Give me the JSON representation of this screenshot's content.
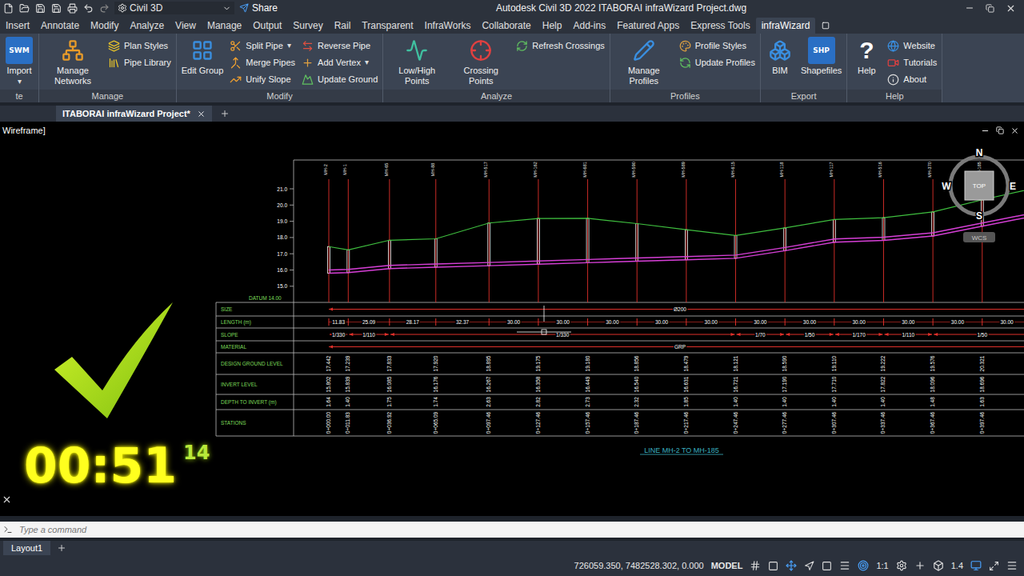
{
  "title_bar": {
    "workspace": "Civil 3D",
    "share": "Share",
    "title": "Autodesk Civil 3D 2022  ITABORAI infraWizard Project.dwg"
  },
  "menu_tabs": [
    {
      "label": "Insert",
      "selected": false
    },
    {
      "label": "Annotate",
      "selected": false
    },
    {
      "label": "Modify",
      "selected": false
    },
    {
      "label": "Analyze",
      "selected": false
    },
    {
      "label": "View",
      "selected": false
    },
    {
      "label": "Manage",
      "selected": false
    },
    {
      "label": "Output",
      "selected": false
    },
    {
      "label": "Survey",
      "selected": false
    },
    {
      "label": "Rail",
      "selected": false
    },
    {
      "label": "Transparent",
      "selected": false
    },
    {
      "label": "InfraWorks",
      "selected": false
    },
    {
      "label": "Collaborate",
      "selected": false
    },
    {
      "label": "Help",
      "selected": false
    },
    {
      "label": "Add-ins",
      "selected": false
    },
    {
      "label": "Featured Apps",
      "selected": false
    },
    {
      "label": "Express Tools",
      "selected": false
    },
    {
      "label": "infraWizard",
      "selected": true
    }
  ],
  "ribbon": {
    "panels": [
      {
        "label": "te",
        "items": [
          {
            "kind": "large",
            "label": "Import",
            "caret": "▾",
            "badge": "SWM"
          }
        ]
      },
      {
        "label": "Manage",
        "items": [
          {
            "kind": "large",
            "label": "Manage Networks"
          },
          {
            "kind": "stack",
            "tools": [
              {
                "label": "Plan Styles"
              },
              {
                "label": "Pipe Library"
              }
            ]
          }
        ]
      },
      {
        "label": "Modify",
        "items": [
          {
            "kind": "large",
            "label": "Edit Group"
          },
          {
            "kind": "stack",
            "tools": [
              {
                "label": "Split Pipe",
                "caret": "▾"
              },
              {
                "label": "Merge Pipes"
              },
              {
                "label": "Unify Slope"
              }
            ]
          },
          {
            "kind": "stack",
            "tools": [
              {
                "label": "Reverse Pipe"
              },
              {
                "label": "Add Vertex",
                "caret": "▾"
              },
              {
                "label": "Update Ground"
              }
            ]
          }
        ]
      },
      {
        "label": "Analyze",
        "items": [
          {
            "kind": "large",
            "label": "Low/High Points"
          },
          {
            "kind": "large",
            "label": "Crossing Points"
          },
          {
            "kind": "stack",
            "tools": [
              {
                "label": "Refresh Crossings"
              }
            ]
          }
        ]
      },
      {
        "label": "Profiles",
        "items": [
          {
            "kind": "large",
            "label": "Manage Profiles"
          },
          {
            "kind": "stack",
            "tools": [
              {
                "label": "Profile Styles"
              },
              {
                "label": "Update Profiles"
              }
            ]
          }
        ]
      },
      {
        "label": "Export",
        "items": [
          {
            "kind": "large",
            "label": "BIM"
          },
          {
            "kind": "large",
            "label": "Shapefiles",
            "badge": "SHP"
          }
        ]
      },
      {
        "label": "Help",
        "items": [
          {
            "kind": "large",
            "label": "Help",
            "glyph": "?"
          },
          {
            "kind": "stack",
            "tools": [
              {
                "label": "Website"
              },
              {
                "label": "Tutorials"
              },
              {
                "label": "About"
              }
            ]
          }
        ]
      }
    ]
  },
  "document_tabs": [
    {
      "label": "ITABORAI infraWizard Project*",
      "selected": true
    }
  ],
  "viewport": {
    "label": "Wireframe]"
  },
  "profile": {
    "title": "LINE MH-2 TO MH-185",
    "datum": "DATUM 14.00",
    "axis_ticks": [
      {
        "label": "21.0",
        "value": 21
      },
      {
        "label": "20.0",
        "value": 20
      },
      {
        "label": "19.0",
        "value": 19
      },
      {
        "label": "18.0",
        "value": 18
      },
      {
        "label": "17.0",
        "value": 17
      },
      {
        "label": "16.0",
        "value": 16
      },
      {
        "label": "15.0",
        "value": 15
      }
    ],
    "manholes": [
      {
        "name": "MH-2",
        "chainage": 0,
        "station": "0+000.00",
        "ground": 17.442,
        "ground_text": "17.442",
        "invert": 15.802,
        "invert_text": "15.802",
        "depth_text": "1.64"
      },
      {
        "name": "MH-1",
        "chainage": 11.83,
        "station": "0+011.83",
        "ground": 17.239,
        "ground_text": "17.239",
        "invert": 15.839,
        "invert_text": "15.839",
        "depth_text": "1.40"
      },
      {
        "name": "MH-65",
        "chainage": 36.92,
        "station": "0+036.92",
        "ground": 17.833,
        "ground_text": "17.833",
        "invert": 16.085,
        "invert_text": "16.085",
        "depth_text": "1.75"
      },
      {
        "name": "MH-88",
        "chainage": 65.09,
        "station": "0+065.09",
        "ground": 17.92,
        "ground_text": "17.920",
        "invert": 16.176,
        "invert_text": "16.176",
        "depth_text": "1.74"
      },
      {
        "name": "MH-517",
        "chainage": 97.46,
        "station": "0+097.46",
        "ground": 18.895,
        "ground_text": "18.895",
        "invert": 16.267,
        "invert_text": "16.267",
        "depth_text": "2.63"
      },
      {
        "name": "MH-162",
        "chainage": 127.46,
        "station": "0+127.46",
        "ground": 19.175,
        "ground_text": "19.175",
        "invert": 16.358,
        "invert_text": "16.358",
        "depth_text": "2.82"
      },
      {
        "name": "MH-681",
        "chainage": 157.46,
        "station": "0+157.46",
        "ground": 19.18,
        "ground_text": "19.180",
        "invert": 16.449,
        "invert_text": "16.449",
        "depth_text": "2.73"
      },
      {
        "name": "MH-590",
        "chainage": 187.46,
        "station": "0+187.46",
        "ground": 18.856,
        "ground_text": "18.856",
        "invert": 16.54,
        "invert_text": "16.540",
        "depth_text": "2.32"
      },
      {
        "name": "MH-589",
        "chainage": 217.46,
        "station": "0+217.46",
        "ground": 18.479,
        "ground_text": "18.479",
        "invert": 16.631,
        "invert_text": "16.631",
        "depth_text": "1.85"
      },
      {
        "name": "MH-615",
        "chainage": 247.46,
        "station": "0+247.46",
        "ground": 18.121,
        "ground_text": "18.121",
        "invert": 16.721,
        "invert_text": "16.721",
        "depth_text": "1.40"
      },
      {
        "name": "MH-118",
        "chainage": 277.46,
        "station": "0+277.46",
        "ground": 18.59,
        "ground_text": "18.590",
        "invert": 17.19,
        "invert_text": "17.190",
        "depth_text": "1.40"
      },
      {
        "name": "MH-117",
        "chainage": 307.46,
        "station": "0+307.46",
        "ground": 19.11,
        "ground_text": "19.110",
        "invert": 17.71,
        "invert_text": "17.710",
        "depth_text": "1.40"
      },
      {
        "name": "MH-516",
        "chainage": 337.46,
        "station": "0+337.46",
        "ground": 19.222,
        "ground_text": "19.222",
        "invert": 17.822,
        "invert_text": "17.822",
        "depth_text": "1.40"
      },
      {
        "name": "MH-370",
        "chainage": 367.46,
        "station": "0+367.46",
        "ground": 19.576,
        "ground_text": "19.576",
        "invert": 18.096,
        "invert_text": "18.096",
        "depth_text": "1.48"
      },
      {
        "name": "MH-185",
        "chainage": 397.46,
        "station": "0+397.46",
        "ground": 20.321,
        "ground_text": "20.321",
        "invert": 18.696,
        "invert_text": "18.696",
        "depth_text": "1.63"
      }
    ],
    "end": {
      "chainage": 427.46,
      "ground": 21.0,
      "invert": 19.296
    },
    "size": "Ø200",
    "material": "GRP",
    "lengths": [
      "11.83",
      "25.09",
      "28.17",
      "32.37",
      "30.00",
      "30.00",
      "30.00",
      "30.00",
      "30.00",
      "30.00",
      "30.00",
      "30.00",
      "30.00",
      "30.00",
      "30.00"
    ],
    "slopes": [
      {
        "text": "1/330",
        "from": 0,
        "to": 1
      },
      {
        "text": "1/110",
        "from": 1,
        "to": 2
      },
      {
        "text": "1/330",
        "from": 2,
        "to": 9
      },
      {
        "text": "1/70",
        "from": 9,
        "to": 10
      },
      {
        "text": "1/50",
        "from": 10,
        "to": 11
      },
      {
        "text": "1/170",
        "from": 11,
        "to": 12
      },
      {
        "text": "1/110",
        "from": 12,
        "to": 13
      },
      {
        "text": "1/50",
        "from": 13,
        "to": 15
      }
    ],
    "rows": [
      {
        "label": "SIZE",
        "kind": "size"
      },
      {
        "label": "LENGTH (m)",
        "kind": "length"
      },
      {
        "label": "SLOPE",
        "kind": "slope"
      },
      {
        "label": "MATERIAL",
        "kind": "material"
      },
      {
        "label": "DESIGN GROUND LEVEL",
        "kind": "ground"
      },
      {
        "label": "INVERT LEVEL",
        "kind": "invert"
      },
      {
        "label": "DEPTH TO INVERT (m)",
        "kind": "depth"
      },
      {
        "label": "STATIONS",
        "kind": "station"
      }
    ]
  },
  "overlay": {
    "timer": "00:51",
    "fraction": "14"
  },
  "viewcube": {
    "north": "N",
    "south": "S",
    "east": "E",
    "west": "W",
    "face": "TOP",
    "ucs": "WCS"
  },
  "command_line": {
    "placeholder": "Type a command"
  },
  "layout_tabs": [
    {
      "label": "Layout1",
      "selected": true
    }
  ],
  "status_bar": {
    "coordinates": "726059.350, 7482528.302, 0.000",
    "space": "MODEL",
    "scale": "1:1",
    "annotation_scale": "1.4"
  }
}
